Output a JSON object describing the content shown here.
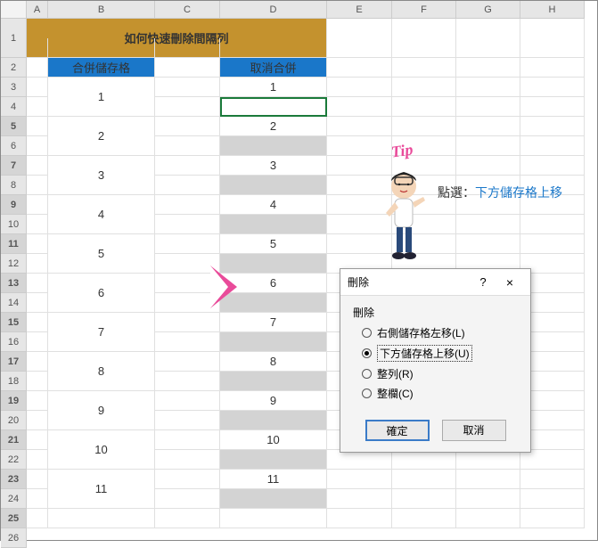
{
  "columns": [
    "A",
    "B",
    "C",
    "D",
    "E",
    "F",
    "G",
    "H"
  ],
  "rows_count": 26,
  "title_banner": "如何快速刪除間隔列",
  "headers": {
    "B3": "合併儲存格",
    "D3": "取消合併"
  },
  "col_b_values": [
    "1",
    "2",
    "3",
    "4",
    "5",
    "6",
    "7",
    "8",
    "9",
    "10",
    "11"
  ],
  "col_d_values": [
    "1",
    "2",
    "3",
    "4",
    "5",
    "6",
    "7",
    "8",
    "9",
    "10",
    "11"
  ],
  "tip_label": "Tip",
  "callout_prefix": "點選：",
  "callout_hi": "下方儲存格上移",
  "dialog": {
    "title": "刪除",
    "group_label": "刪除",
    "opt1": "右側儲存格左移(L)",
    "opt2": "下方儲存格上移(U)",
    "opt3": "整列(R)",
    "opt4": "整欄(C)",
    "ok": "確定",
    "cancel": "取消",
    "help": "?",
    "close": "×"
  }
}
